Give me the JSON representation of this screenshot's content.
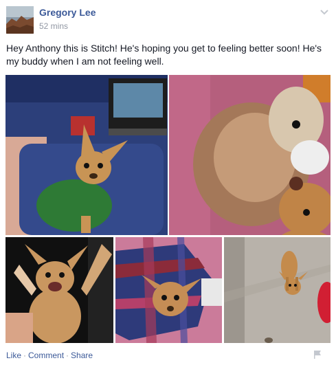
{
  "post": {
    "author": "Gregory Lee",
    "timestamp": "52 mins",
    "message": "Hey Anthony this is Stitch! He's hoping you get to feeling better soon! He's my buddy when I am not feeling well.",
    "menu_icon": "chevron-down-icon",
    "avatar_icon": "avatar"
  },
  "photos": [
    {
      "id": "photo-1",
      "subject": "chihuahua in green sweater on blue couch with laptop"
    },
    {
      "id": "photo-2",
      "subject": "chihuahua with plush teddy bear"
    },
    {
      "id": "photo-3",
      "subject": "chihuahua standing up pawing"
    },
    {
      "id": "photo-4",
      "subject": "chihuahua on plaid blanket"
    },
    {
      "id": "photo-5",
      "subject": "chihuahua on floor"
    }
  ],
  "footer": {
    "like": "Like",
    "comment": "Comment",
    "share": "Share",
    "separator": "·",
    "flag_icon": "flag-icon"
  },
  "colors": {
    "link": "#3b5998",
    "meta": "#9197a3",
    "text": "#141823"
  }
}
